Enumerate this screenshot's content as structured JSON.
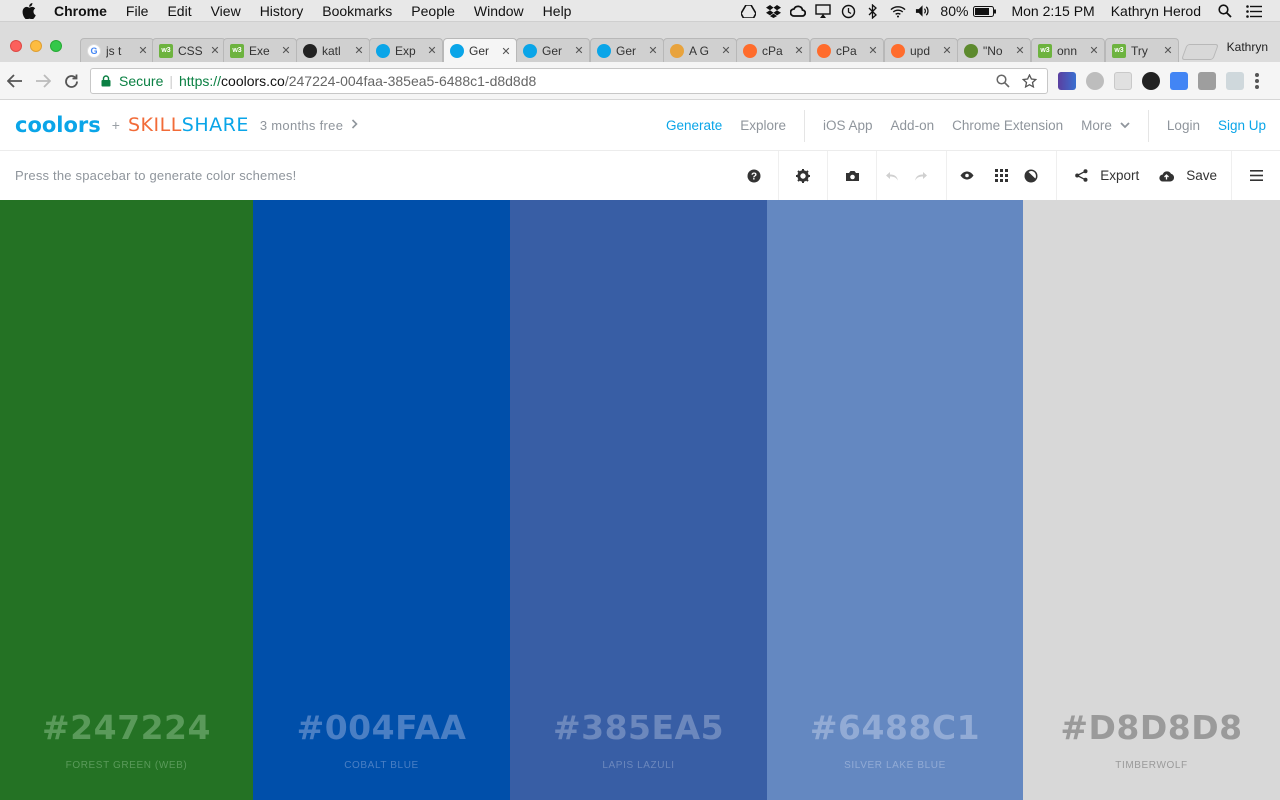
{
  "menubar": {
    "items": [
      "Chrome",
      "File",
      "Edit",
      "View",
      "History",
      "Bookmarks",
      "People",
      "Window",
      "Help"
    ],
    "battery": "80%",
    "clock": "Mon 2:15 PM",
    "user": "Kathryn Herod"
  },
  "tabs": [
    {
      "title": "js t",
      "favicon": "google-icon",
      "color": "#ffffff"
    },
    {
      "title": "CSS",
      "favicon": "w3schools-icon",
      "color": "#6db33f"
    },
    {
      "title": "Exe",
      "favicon": "w3schools-icon",
      "color": "#6db33f"
    },
    {
      "title": "katl",
      "favicon": "github-icon",
      "color": "#222222"
    },
    {
      "title": "Exp",
      "favicon": "coolors-icon",
      "color": "#0aa5e8"
    },
    {
      "title": "Ger",
      "favicon": "coolors-icon",
      "color": "#0aa5e8"
    },
    {
      "title": "Ger",
      "favicon": "coolors-icon",
      "color": "#0aa5e8"
    },
    {
      "title": "Ger",
      "favicon": "coolors-icon",
      "color": "#0aa5e8"
    },
    {
      "title": "A G",
      "favicon": "book-icon",
      "color": "#e8a33d"
    },
    {
      "title": "cPa",
      "favicon": "cpanel-icon",
      "color": "#ff6c2c"
    },
    {
      "title": "cPa",
      "favicon": "cpanel-icon",
      "color": "#ff6c2c"
    },
    {
      "title": "upd",
      "favicon": "cpanel-icon",
      "color": "#ff6c2c"
    },
    {
      "title": "\"No",
      "favicon": "tree-icon",
      "color": "#5d8a2e"
    },
    {
      "title": "onn",
      "favicon": "w3schools-icon",
      "color": "#6db33f"
    },
    {
      "title": "Try",
      "favicon": "w3schools-icon",
      "color": "#6db33f"
    }
  ],
  "active_tab_index": 5,
  "profile_name": "Kathryn",
  "address": {
    "secure_label": "Secure",
    "url_proto": "https://",
    "url_host": "coolors.co",
    "url_path": "/247224-004faa-385ea5-6488c1-d8d8d8"
  },
  "site": {
    "logo": "coolors",
    "plus": "+",
    "skill": "SKILL",
    "share": "SHARE",
    "promo": "3 months free",
    "nav": {
      "generate": "Generate",
      "explore": "Explore",
      "ios": "iOS App",
      "addon": "Add-on",
      "chrome_ext": "Chrome Extension",
      "more": "More",
      "login": "Login",
      "signup": "Sign Up"
    }
  },
  "generator": {
    "hint": "Press the spacebar to generate color schemes!",
    "export": "Export",
    "save": "Save"
  },
  "palette": [
    {
      "hex": "#247224",
      "name": "FOREST GREEN (WEB)",
      "bg": "#247224",
      "text_color": "#5a9a5a"
    },
    {
      "hex": "#004FAA",
      "name": "COBALT BLUE",
      "bg": "#004faa",
      "text_color": "#4a7fc4"
    },
    {
      "hex": "#385EA5",
      "name": "LAPIS LAZULI",
      "bg": "#385ea5",
      "text_color": "#6c88bd"
    },
    {
      "hex": "#6488C1",
      "name": "SILVER LAKE BLUE",
      "bg": "#6488c1",
      "text_color": "#92abd5"
    },
    {
      "hex": "#D8D8D8",
      "name": "TIMBERWOLF",
      "bg": "#d8d8d8",
      "text_color": "#9a9a9a"
    }
  ]
}
